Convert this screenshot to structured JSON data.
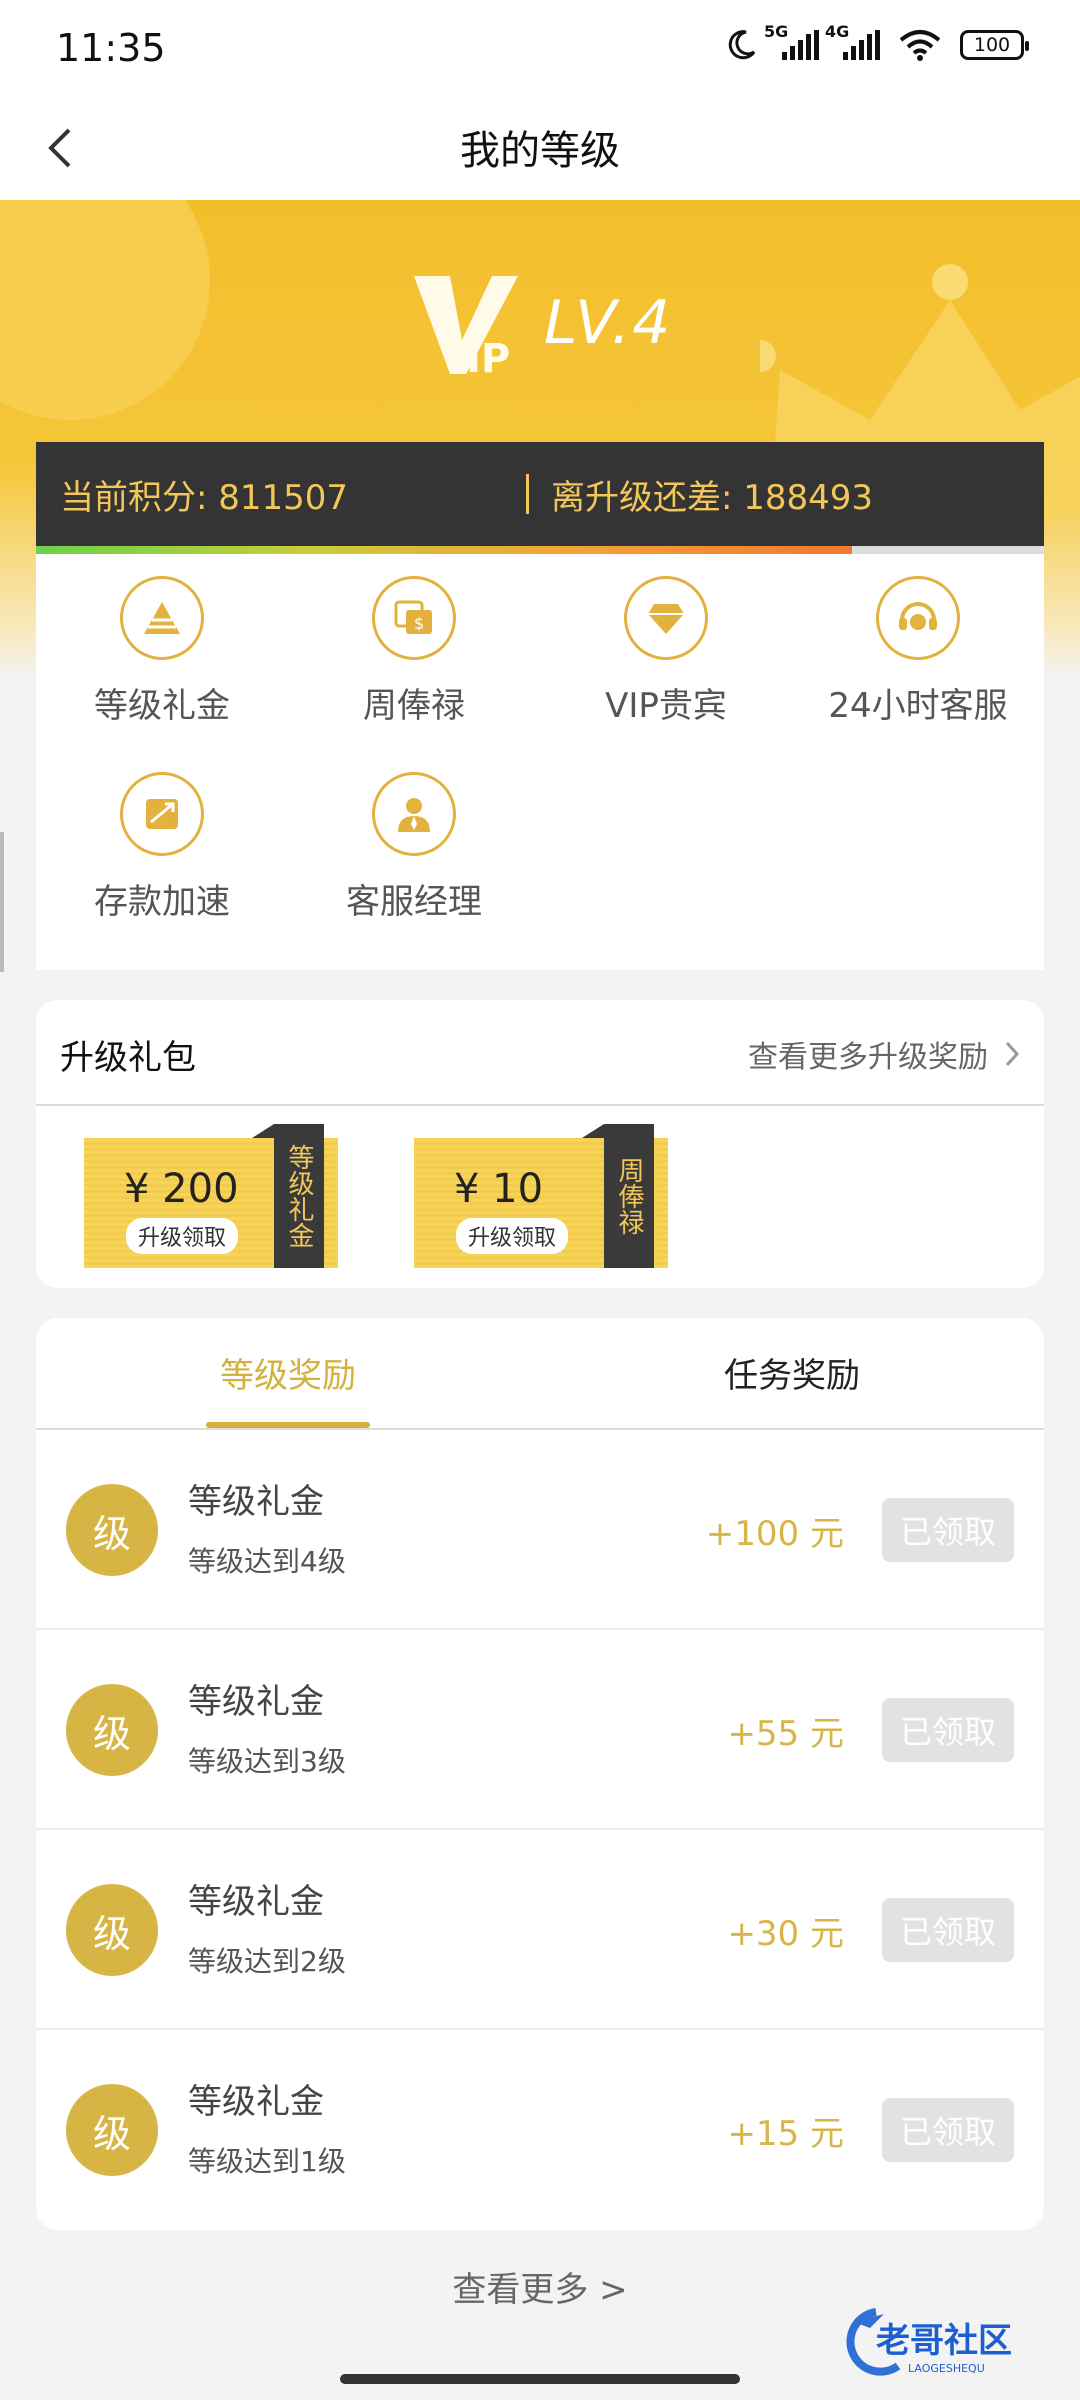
{
  "status_bar": {
    "time": "11:35",
    "signal1_tag": "5G",
    "signal2_tag": "4G",
    "battery": "100"
  },
  "nav": {
    "title": "我的等级"
  },
  "vip": {
    "level_text": "LV.4",
    "logo_text": "VIP"
  },
  "points": {
    "current_label": "当前积分: 811507",
    "remaining_label": "离升级还差: 188493",
    "progress_fraction": 0.81
  },
  "perks": [
    {
      "label": "等级礼金",
      "icon": "tier-pyramid-icon"
    },
    {
      "label": "周俸禄",
      "icon": "salary-icon"
    },
    {
      "label": "VIP贵宾",
      "icon": "diamond-icon"
    },
    {
      "label": "24小时客服",
      "icon": "headset-icon"
    },
    {
      "label": "存款加速",
      "icon": "deposit-speed-icon"
    },
    {
      "label": "客服经理",
      "icon": "manager-icon"
    }
  ],
  "upgrade_gift": {
    "title": "升级礼包",
    "more_label": "查看更多升级奖励",
    "coupons": [
      {
        "amount": "¥ 200",
        "pill": "升级领取",
        "ribbon": "等级礼金"
      },
      {
        "amount": "¥ 10",
        "pill": "升级领取",
        "ribbon": "周俸禄"
      }
    ]
  },
  "rewards": {
    "tabs": [
      "等级奖励",
      "任务奖励"
    ],
    "items": [
      {
        "badge": "级",
        "title": "等级礼金",
        "sub": "等级达到4级",
        "amount": "+100 元",
        "status": "已领取"
      },
      {
        "badge": "级",
        "title": "等级礼金",
        "sub": "等级达到3级",
        "amount": "+55 元",
        "status": "已领取"
      },
      {
        "badge": "级",
        "title": "等级礼金",
        "sub": "等级达到2级",
        "amount": "+30 元",
        "status": "已领取"
      },
      {
        "badge": "级",
        "title": "等级礼金",
        "sub": "等级达到1级",
        "amount": "+15 元",
        "status": "已领取"
      }
    ]
  },
  "footer": {
    "see_more": "查看更多 >",
    "watermark": "老哥社区",
    "watermark_sub": "LAOGESHEQU"
  },
  "colors": {
    "gold": "#d4b13c",
    "header_yellow": "#f3be2b",
    "dark_bar": "#343434"
  }
}
